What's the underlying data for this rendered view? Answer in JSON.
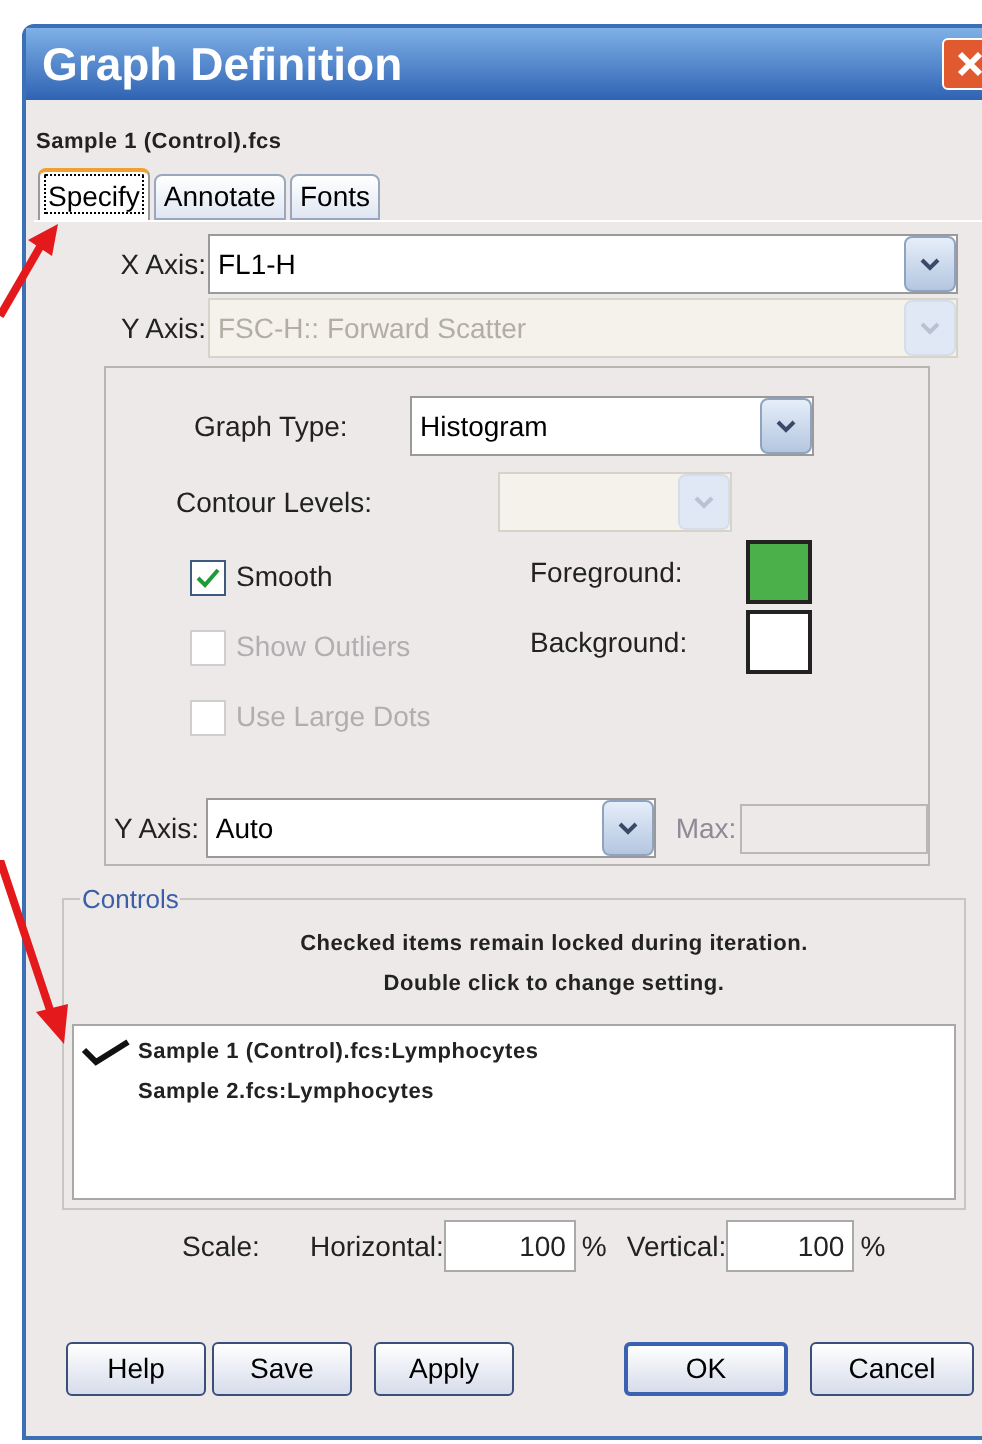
{
  "window": {
    "title": "Graph Definition"
  },
  "file_name": "Sample 1 (Control).fcs",
  "tabs": [
    {
      "label": "Specify",
      "selected": true
    },
    {
      "label": "Annotate",
      "selected": false
    },
    {
      "label": "Fonts",
      "selected": false
    }
  ],
  "x_axis": {
    "label": "X Axis:",
    "value": "FL1-H",
    "disabled": false
  },
  "y_axis": {
    "label": "Y Axis:",
    "value": "FSC-H:: Forward Scatter",
    "disabled": true
  },
  "graph_type": {
    "label": "Graph Type:",
    "value": "Histogram"
  },
  "contour_levels": {
    "label": "Contour Levels:",
    "disabled": true
  },
  "options": [
    {
      "label": "Smooth",
      "checked": true,
      "disabled": false
    },
    {
      "label": "Show Outliers",
      "checked": false,
      "disabled": true
    },
    {
      "label": "Use Large Dots",
      "checked": false,
      "disabled": true
    }
  ],
  "colors": [
    {
      "label": "Foreground:",
      "color": "#4cb04a"
    },
    {
      "label": "Background:",
      "color": "#ffffff"
    }
  ],
  "y_scale": {
    "label": "Y Axis:",
    "value": "Auto"
  },
  "max": {
    "label": "Max:",
    "disabled": true
  },
  "controls": {
    "title": "Controls",
    "hint": "Checked items remain locked during iteration.\nDouble click to change setting.",
    "items": [
      {
        "label": "Sample 1 (Control).fcs:Lymphocytes",
        "checked": true
      },
      {
        "label": "Sample 2.fcs:Lymphocytes",
        "checked": false
      }
    ]
  },
  "scale": {
    "label": "Scale:",
    "horizontal_label": "Horizontal:",
    "horizontal": "100",
    "vertical_label": "Vertical:",
    "vertical": "100",
    "unit": "%"
  },
  "buttons": [
    {
      "label": "Help",
      "default": false
    },
    {
      "label": "Save",
      "default": false
    },
    {
      "label": "Apply",
      "default": false
    },
    {
      "label": "OK",
      "default": true
    },
    {
      "label": "Cancel",
      "default": false
    }
  ]
}
